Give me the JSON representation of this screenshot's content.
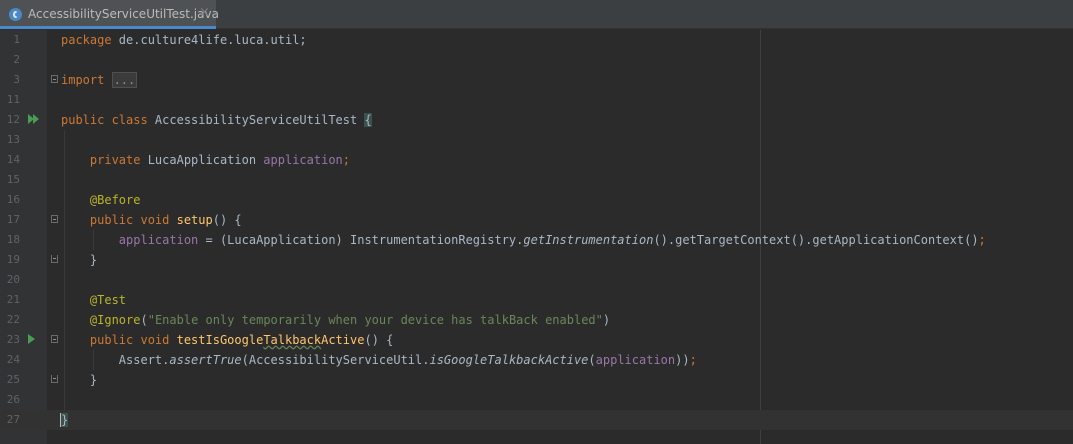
{
  "tab": {
    "title": "AccessibilityServiceUtilTest.java",
    "close": "×",
    "icon": "java-class-icon"
  },
  "colors": {
    "background": "#2b2b2b",
    "keyword": "#cc7832",
    "field": "#9876aa",
    "annotation": "#bbb529",
    "string": "#6a8759",
    "method": "#ffc66d",
    "text": "#a9b7c6",
    "linenumber": "#606366"
  },
  "lines": [
    {
      "n": "1",
      "t": [
        [
          "kw",
          "package "
        ],
        [
          "pl",
          "de.culture4life.luca.util;"
        ]
      ]
    },
    {
      "n": "2",
      "t": []
    },
    {
      "n": "3",
      "t": [
        [
          "kw",
          "import "
        ],
        [
          "folded",
          "..."
        ]
      ]
    },
    {
      "n": "11",
      "t": []
    },
    {
      "n": "12",
      "t": [
        [
          "kw",
          "public class "
        ],
        [
          "pl",
          "AccessibilityServiceUtilTest "
        ],
        [
          "bhl",
          "{"
        ]
      ]
    },
    {
      "n": "13",
      "t": []
    },
    {
      "n": "14",
      "t": [
        [
          "pl",
          "    "
        ],
        [
          "kw",
          "private "
        ],
        [
          "pl",
          "LucaApplication "
        ],
        [
          "fld",
          "application"
        ],
        [
          "kw",
          ";"
        ]
      ]
    },
    {
      "n": "15",
      "t": []
    },
    {
      "n": "16",
      "t": [
        [
          "pl",
          "    "
        ],
        [
          "ann",
          "@Before"
        ]
      ]
    },
    {
      "n": "17",
      "t": [
        [
          "pl",
          "    "
        ],
        [
          "kw",
          "public void "
        ],
        [
          "fn",
          "setup"
        ],
        [
          "pl",
          "() {"
        ]
      ]
    },
    {
      "n": "18",
      "t": [
        [
          "pl",
          "        "
        ],
        [
          "fld",
          "application "
        ],
        [
          "pl",
          "= (LucaApplication) InstrumentationRegistry."
        ],
        [
          "it",
          "getInstrumentation"
        ],
        [
          "pl",
          "().getTargetContext().getApplicationContext()"
        ],
        [
          "kw",
          ";"
        ]
      ]
    },
    {
      "n": "19",
      "t": [
        [
          "pl",
          "    }"
        ]
      ]
    },
    {
      "n": "20",
      "t": []
    },
    {
      "n": "21",
      "t": [
        [
          "pl",
          "    "
        ],
        [
          "ann",
          "@Test"
        ]
      ]
    },
    {
      "n": "22",
      "t": [
        [
          "pl",
          "    "
        ],
        [
          "ann",
          "@Ignore"
        ],
        [
          "pl",
          "("
        ],
        [
          "str",
          "\"Enable only temporarily when your device has talkBack enabled\""
        ],
        [
          "pl",
          ")"
        ]
      ]
    },
    {
      "n": "23",
      "t": [
        [
          "pl",
          "    "
        ],
        [
          "kw",
          "public void "
        ],
        [
          "fn",
          "testIsGoogle"
        ],
        [
          "fnsq",
          "Talkback"
        ],
        [
          "fn",
          "Active"
        ],
        [
          "pl",
          "() {"
        ]
      ]
    },
    {
      "n": "24",
      "t": [
        [
          "pl",
          "        Assert."
        ],
        [
          "it",
          "assertTrue"
        ],
        [
          "pl",
          "(AccessibilityServiceUtil."
        ],
        [
          "it",
          "isGoogleTalkbackActive"
        ],
        [
          "pl",
          "("
        ],
        [
          "fld",
          "application"
        ],
        [
          "pl",
          "))"
        ],
        [
          "kw",
          ";"
        ]
      ]
    },
    {
      "n": "25",
      "t": [
        [
          "pl",
          "    }"
        ]
      ]
    },
    {
      "n": "26",
      "t": []
    },
    {
      "n": "27",
      "t": [
        [
          "bhlc",
          "}"
        ]
      ]
    }
  ]
}
